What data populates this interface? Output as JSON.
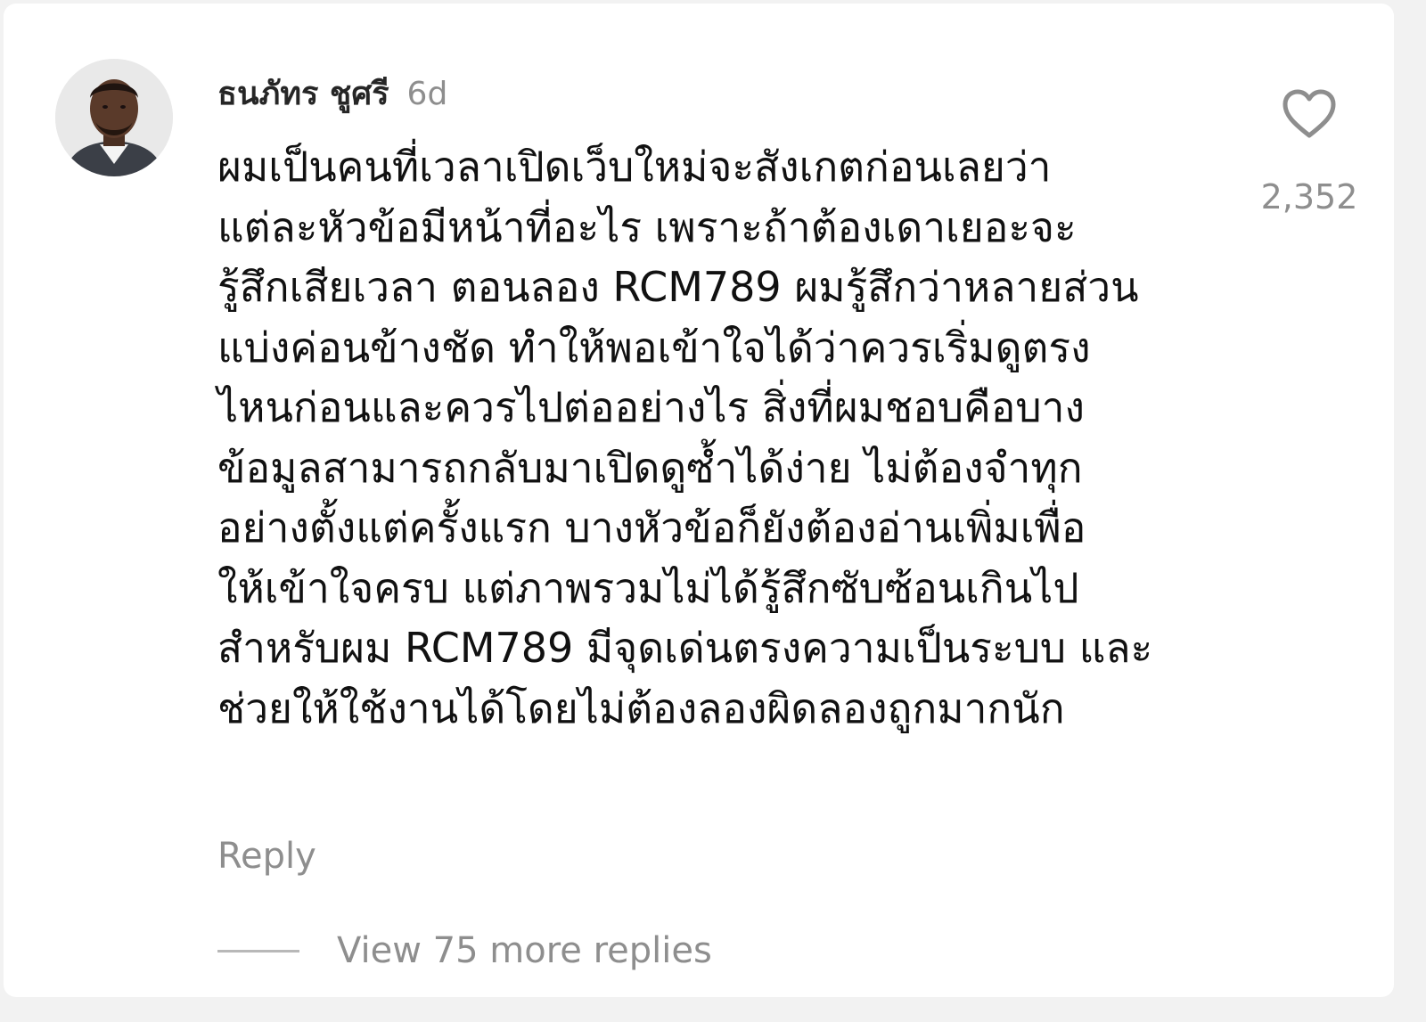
{
  "comment": {
    "author": "ธนภัทร ชูศรี",
    "timestamp": "6d",
    "avatar_icon": "user-avatar-photo",
    "lines": [
      "ผมเป็นคนที่เวลาเปิดเว็บใหม่จะสังเกตก่อนเลยว่า",
      "แต่ละหัวข้อมีหน้าที่อะไร เพราะถ้าต้องเดาเยอะจะ",
      "รู้สึกเสียเวลา ตอนลอง RCM789 ผมรู้สึกว่าหลายส่วน",
      "แบ่งค่อนข้างชัด ทำให้พอเข้าใจได้ว่าควรเริ่มดูตรง",
      "ไหนก่อนและควรไปต่ออย่างไร สิ่งที่ผมชอบคือบาง",
      "ข้อมูลสามารถกลับมาเปิดดูซ้ำได้ง่าย ไม่ต้องจำทุก",
      "อย่างตั้งแต่ครั้งแรก บางหัวข้อก็ยังต้องอ่านเพิ่มเพื่อ",
      "ให้เข้าใจครบ แต่ภาพรวมไม่ได้รู้สึกซับซ้อนเกินไป",
      "สำหรับผม RCM789 มีจุดเด่นตรงความเป็นระบบ และ",
      "ช่วยให้ใช้งานได้โดยไม่ต้องลองผิดลองถูกมากนัก"
    ],
    "like_icon": "heart-icon",
    "like_count": "2,352",
    "reply_label": "Reply",
    "view_replies_label": "View 75 more replies"
  },
  "colors": {
    "primary_text": "#111111",
    "secondary_text": "#8e8e8e",
    "background": "#ffffff"
  }
}
